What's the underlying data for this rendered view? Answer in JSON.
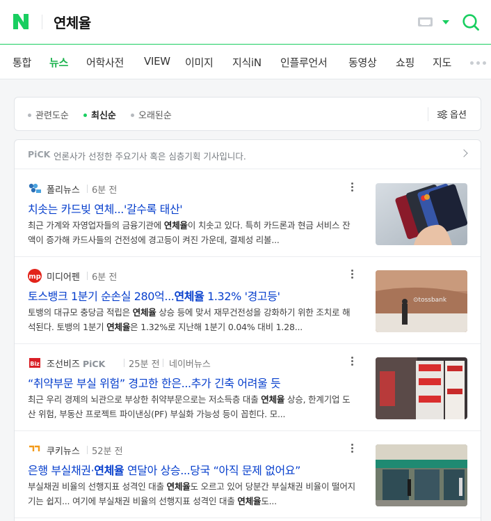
{
  "header": {
    "query": "연체율",
    "logo_letter": "N",
    "brand_color": "#19ce60"
  },
  "tabs": [
    {
      "label": "통합"
    },
    {
      "label": "뉴스"
    },
    {
      "label": "어학사전"
    },
    {
      "label": "VIEW"
    },
    {
      "label": "이미지"
    },
    {
      "label": "지식iN"
    },
    {
      "label": "인플루언서"
    },
    {
      "label": "동영상"
    },
    {
      "label": "쇼핑"
    },
    {
      "label": "지도"
    }
  ],
  "active_tab": "뉴스",
  "sort": {
    "options": [
      {
        "label": "관련도순"
      },
      {
        "label": "최신순"
      },
      {
        "label": "오래된순"
      }
    ],
    "active": "최신순",
    "options_button": "옵션"
  },
  "pick": {
    "label": "PiCK",
    "description": "언론사가 선정한 주요기사 혹은 심층기획 기사입니다."
  },
  "articles": [
    {
      "press": "폴리뉴스",
      "time": "6분 전",
      "title_parts": [
        "치솟는 카드빚 연체...'갈수록 태산'"
      ],
      "snippet_html": "최근 가계와 자영업자들의 금융기관에 <b>연체율</b>이 치솟고 있다. 특히 카드론과 현금 서비스 잔액이 증가해 카드사들의 건전성에 경고등이 켜진 가운데, 결제성 리볼...",
      "thumb_icon": "credit-cards-photo"
    },
    {
      "press": "미디어펜",
      "time": "6분 전",
      "title_before": "토스뱅크 1분기 순손실 280억...",
      "title_bold": "연체율",
      "title_after": " 1.32% '경고등'",
      "snippet_html": "토뱅의 대규모 충당금 적립은 <b>연체율</b> 상승 등에 맞서 재무건전성을 강화하기 위한 조치로 해석된다. 토뱅의 1분기 <b>연체율</b>은 1.32%로 지난해 1분기 0.04% 대비 1.28...",
      "thumb_icon": "tossbank-office-photo"
    },
    {
      "press": "조선비즈",
      "pick_tag": "PiCK",
      "time": "25분 전",
      "platform": "네이버뉴스",
      "title_parts": [
        "“취약부문 부실 위험” 경고한 한은...추가 긴축 어려울 듯"
      ],
      "snippet_html": "최근 우리 경제의 뇌관으로 부상한 취약부문으로는 저소득층 대출 <b>연체율</b> 상승, 한계기업 도산 위험, 부동산 프로젝트 파이낸싱(PF) 부실화 가능성 등이 꼽힌다. 모...",
      "thumb_icon": "card-loan-signs-photo"
    },
    {
      "press": "쿠키뉴스",
      "time": "52분 전",
      "title_before": "은행 부실채권·",
      "title_bold": "연체율",
      "title_after": " 연달아 상승...당국 “아직 문제 없어요”",
      "snippet_html": "부실채권 비율의 선행지표 성격인 대출 <b>연체율</b>도 오르고 있어 당분간 부실채권 비율이 떨어지기는 쉽지... 여기에 부실채권 비율의 선행지표 성격인 대출 <b>연체율</b>도...",
      "thumb_icon": "bank-atm-street-photo"
    }
  ]
}
